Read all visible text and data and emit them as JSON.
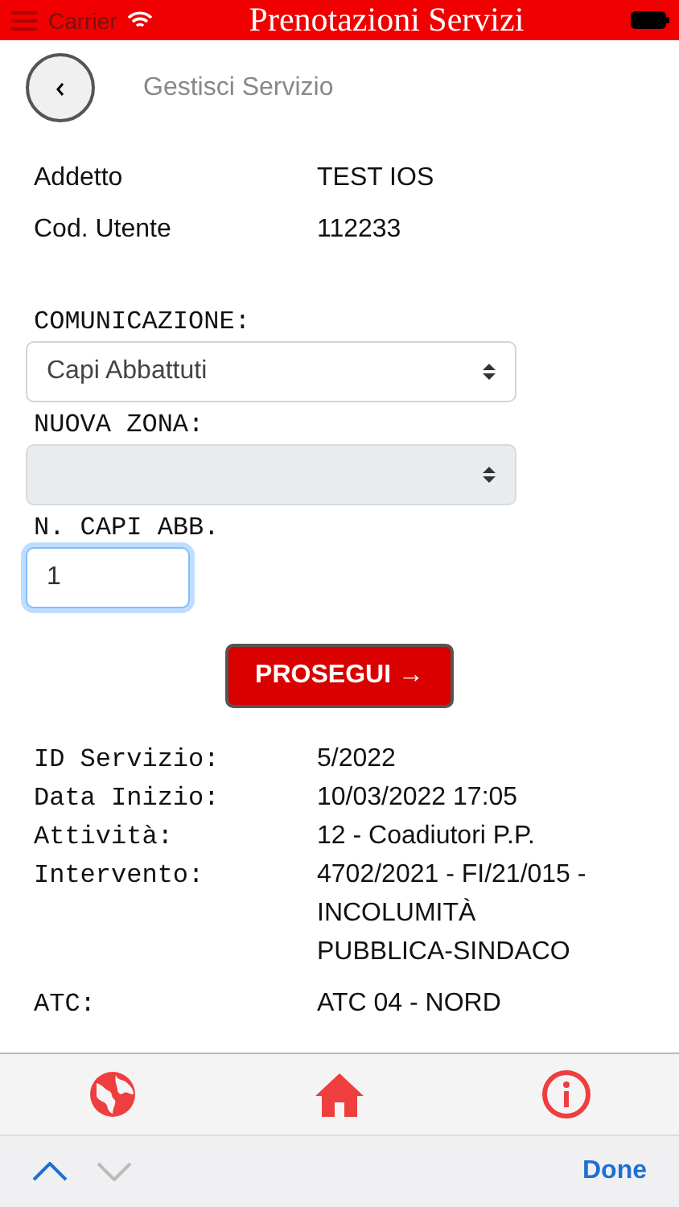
{
  "header": {
    "title": "Prenotazioni Servizi",
    "carrier": "Carrier"
  },
  "page_title": "Gestisci Servizio",
  "user_info": [
    {
      "label": "Addetto",
      "value": "TEST IOS"
    },
    {
      "label": "Cod. Utente",
      "value": "112233"
    }
  ],
  "form": [
    {
      "kind": "select",
      "label": "COMUNICAZIONE:",
      "value": "Capi Abbattuti",
      "disabled": false
    },
    {
      "kind": "select",
      "label": "NUOVA ZONA:",
      "disabled": true
    },
    {
      "kind": "input",
      "label": "N. CAPI ABB.",
      "value": "1",
      "focused": true
    }
  ],
  "submit_button": "PROSEGUI →",
  "service_details": [
    {
      "label": "ID Servizio:",
      "value": "5/2022"
    },
    {
      "label": "Data Inizio:",
      "value": "10/03/2022 17:05"
    },
    {
      "label": "Attività:",
      "value": "12 - Coadiutori P.P."
    },
    {
      "label": "Intervento:",
      "value": "4702/2021 - FI/21/015 - INCOLUMITÀ PUBBLICA-SINDACO"
    },
    {
      "label": "ATC:",
      "value": "ATC 04 - NORD"
    }
  ],
  "tab_bar": [
    {
      "kind": "globe"
    },
    {
      "kind": "home"
    },
    {
      "kind": "info"
    }
  ],
  "keyboard_toolbar": {
    "previous_disabled": false,
    "next_disabled": true,
    "done": "Done"
  }
}
